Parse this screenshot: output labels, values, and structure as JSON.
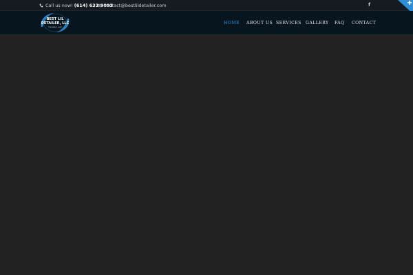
{
  "topbar": {
    "phone_prefix": "Call us now!",
    "phone_number": "(614) 633-9093",
    "email": "contact@bestlildetailer.com",
    "social_icon": "facebook-icon",
    "social_glyph": "f",
    "corner_icon": "plus-icon"
  },
  "header": {
    "logo": {
      "line1": "BEST LIL",
      "line2": "DETAILER, LLC",
      "tagline": "COLUMBUS, OHIO"
    }
  },
  "nav": {
    "items": [
      {
        "label": "HOME",
        "active": true
      },
      {
        "label": "ABOUT US",
        "active": false
      },
      {
        "label": "SERVICES",
        "active": false
      },
      {
        "label": "GALLERY",
        "active": false
      },
      {
        "label": "FAQ",
        "active": false
      },
      {
        "label": "CONTACT",
        "active": false
      }
    ]
  },
  "colors": {
    "accent": "#2f8fd6",
    "topbar_bg": "#161b22",
    "navbar_bg": "#06151e",
    "page_bg": "#222222"
  }
}
